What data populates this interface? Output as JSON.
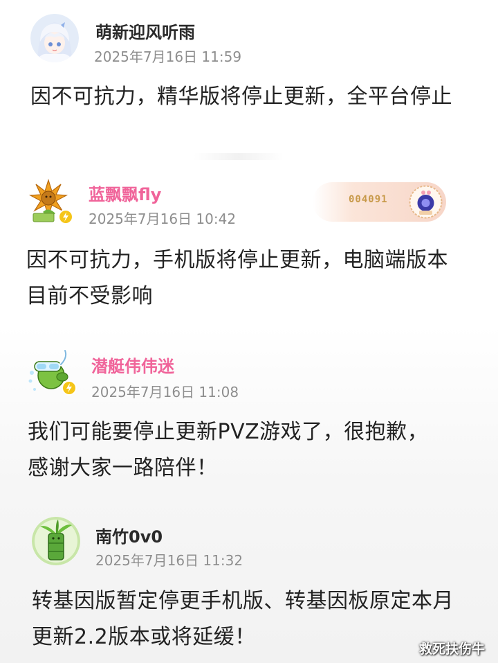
{
  "posts": [
    {
      "username": "萌新迎风听雨",
      "timestamp": "2025年7月16日 11:59",
      "content": "因不可抗力，精华版将停止更新，全平台停止",
      "avatar_icon": "anime-girl-avatar-icon",
      "name_color": "#2a2a2a"
    },
    {
      "username": "蓝飘飘fly",
      "timestamp": "2025年7月16日 10:42",
      "content": "因不可抗力，手机版将停止更新，电脑端版本目前不受影响",
      "avatar_icon": "sunflower-avatar-icon",
      "name_color": "#f0649a",
      "badge_number": "004091"
    },
    {
      "username": "潜艇伟伟迷",
      "timestamp": "2025年7月16日 11:08",
      "content": "我们可能要停止更新PVZ游戏了，很抱歉，感谢大家一路陪伴！",
      "avatar_icon": "snorkel-peashooter-avatar-icon",
      "name_color": "#f0649a"
    },
    {
      "username": "南竹0v0",
      "timestamp": "2025年7月16日 11:32",
      "content": "转基因版暂定停更手机版、转基因板原定本月更新2.2版本或将延缓！",
      "avatar_icon": "bamboo-avatar-icon",
      "name_color": "#2a2a2a"
    }
  ],
  "watermark": "救死扶伤牛"
}
